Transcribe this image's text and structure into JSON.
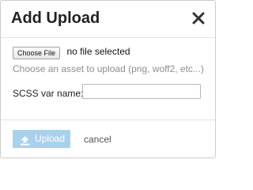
{
  "dialog": {
    "title": "Add Upload",
    "close_icon": "close-icon"
  },
  "file": {
    "button_label": "Choose File",
    "status": "no file selected",
    "hint": "Choose an asset to upload (png, woff2, etc...)"
  },
  "scss_var": {
    "label": "SCSS var name:",
    "value": "",
    "placeholder": ""
  },
  "footer": {
    "upload_label": "Upload",
    "upload_icon": "upload-icon",
    "cancel_label": "cancel"
  },
  "colors": {
    "upload_disabled_bg": "#a8d2ec",
    "hint_text": "#8e8e8e"
  }
}
